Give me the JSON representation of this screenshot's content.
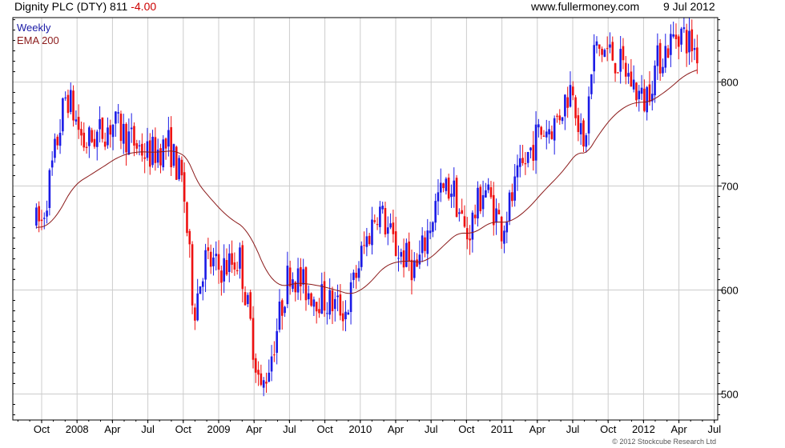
{
  "header": {
    "title": "Dignity PLC (DTY) 811",
    "change": "-4.00",
    "site": "www.fullermoney.com",
    "date": "9 Jul 2012"
  },
  "legend": {
    "weekly": "Weekly",
    "ema": "EMA 200"
  },
  "copyright": "© 2012 Stockcube Research Ltd",
  "colors": {
    "up": "#1a1ae6",
    "down": "#ee1111",
    "ema": "#8b1a1a",
    "grid": "#cccccc",
    "frame": "#000000"
  },
  "chart_data": {
    "type": "candlestick",
    "title": "Dignity PLC (DTY) 811 -4.00",
    "ylim": [
      475,
      862
    ],
    "y_ticks": [
      500,
      600,
      700,
      800
    ],
    "x_ticks": [
      "Oct",
      "2008",
      "Apr",
      "Jul",
      "Oct",
      "2009",
      "Apr",
      "Jul",
      "Oct",
      "2010",
      "Apr",
      "Jul",
      "Oct",
      "2011",
      "Apr",
      "Jul",
      "Oct",
      "2012",
      "Apr",
      "Jul"
    ],
    "x_tick_index": [
      0,
      1,
      2,
      3,
      4,
      5,
      6,
      7,
      8,
      9,
      10,
      11,
      12,
      13,
      14,
      15,
      16,
      17,
      18,
      19
    ],
    "series_key_points": [
      {
        "x": 0,
        "y": 665
      },
      {
        "x": 0.7,
        "y": 790
      },
      {
        "x": 1.2,
        "y": 740
      },
      {
        "x": 2.0,
        "y": 760
      },
      {
        "x": 3.0,
        "y": 730
      },
      {
        "x": 3.6,
        "y": 740
      },
      {
        "x": 4.0,
        "y": 700
      },
      {
        "x": 4.3,
        "y": 580
      },
      {
        "x": 4.6,
        "y": 630
      },
      {
        "x": 5.0,
        "y": 620
      },
      {
        "x": 5.6,
        "y": 630
      },
      {
        "x": 6.2,
        "y": 500
      },
      {
        "x": 6.5,
        "y": 540
      },
      {
        "x": 7.0,
        "y": 620
      },
      {
        "x": 7.5,
        "y": 600
      },
      {
        "x": 8.0,
        "y": 590
      },
      {
        "x": 8.6,
        "y": 580
      },
      {
        "x": 9.0,
        "y": 630
      },
      {
        "x": 9.5,
        "y": 680
      },
      {
        "x": 10.0,
        "y": 640
      },
      {
        "x": 10.6,
        "y": 620
      },
      {
        "x": 11.2,
        "y": 690
      },
      {
        "x": 11.6,
        "y": 700
      },
      {
        "x": 12.0,
        "y": 650
      },
      {
        "x": 12.5,
        "y": 700
      },
      {
        "x": 13.0,
        "y": 660
      },
      {
        "x": 13.5,
        "y": 710
      },
      {
        "x": 14.0,
        "y": 750
      },
      {
        "x": 14.5,
        "y": 760
      },
      {
        "x": 15.0,
        "y": 800
      },
      {
        "x": 15.3,
        "y": 730
      },
      {
        "x": 15.6,
        "y": 830
      },
      {
        "x": 16.0,
        "y": 830
      },
      {
        "x": 16.5,
        "y": 810
      },
      {
        "x": 17.0,
        "y": 780
      },
      {
        "x": 17.4,
        "y": 820
      },
      {
        "x": 18.0,
        "y": 850
      },
      {
        "x": 18.5,
        "y": 830
      },
      {
        "x": 18.8,
        "y": 811
      }
    ]
  }
}
